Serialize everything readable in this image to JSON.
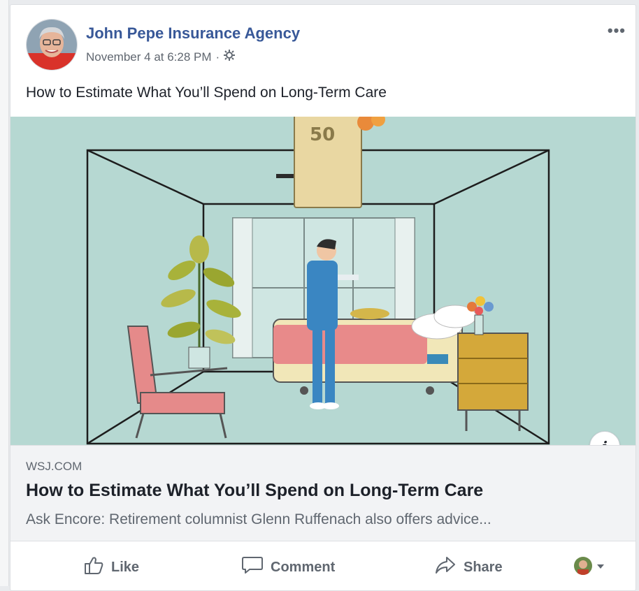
{
  "post": {
    "author": "John Pepe Insurance Agency",
    "timestamp": "November 4 at 6:28 PM",
    "separator": "·",
    "audience_icon": "gear-icon",
    "more_label": "•••",
    "text": "How to Estimate What You’ll Spend on Long-Term Care"
  },
  "hero": {
    "money_label": "50"
  },
  "link": {
    "domain": "WSJ.COM",
    "title": "How to Estimate What You’ll Spend on Long-Term Care",
    "description": "Ask Encore: Retirement columnist Glenn Ruffenach also offers advice...",
    "info_label": "i"
  },
  "actions": {
    "like": "Like",
    "comment": "Comment",
    "share": "Share"
  },
  "colors": {
    "author_link": "#385898",
    "hero_bg": "#b6d8d2",
    "secondary_text": "#606770"
  }
}
